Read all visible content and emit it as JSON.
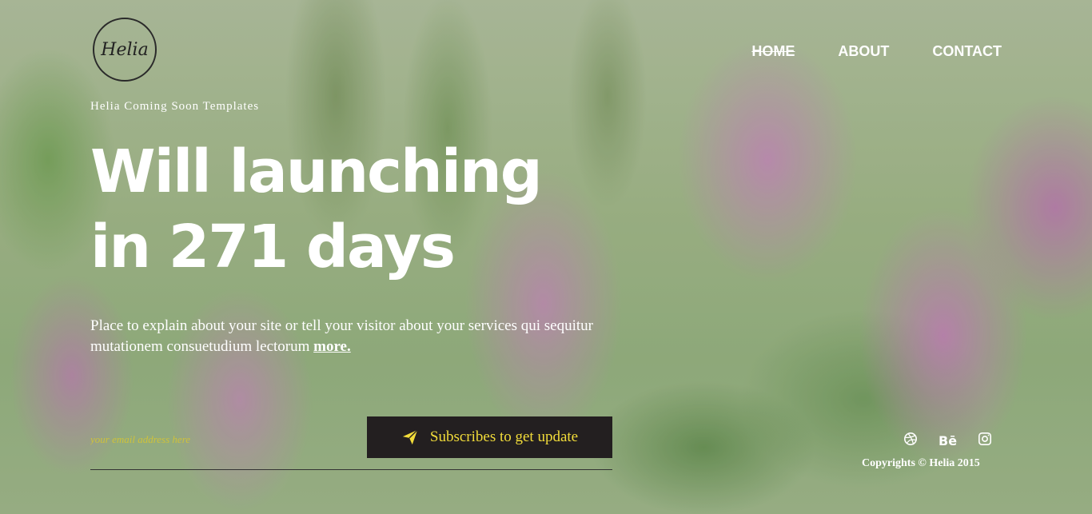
{
  "brand": {
    "logo_text": "Helia",
    "tagline": "Helia Coming Soon Templates"
  },
  "nav": {
    "items": [
      {
        "label": "HOME"
      },
      {
        "label": "ABOUT"
      },
      {
        "label": "CONTACT"
      }
    ]
  },
  "hero": {
    "headline_line1": "Will launching",
    "headline_line2": "in 271 days",
    "description": "Place to explain about your site or tell your visitor about your services qui sequitur mutationem consuetudium lectorum",
    "more_link": "more."
  },
  "subscribe": {
    "placeholder": "your email address here",
    "button_label": "Subscribes to get update",
    "button_icon": "paper-plane-icon"
  },
  "social": {
    "icons": [
      "dribbble-icon",
      "behance-icon",
      "instagram-icon"
    ],
    "behance_text": "Bē"
  },
  "footer": {
    "copyright": "Copyrights © Helia 2015"
  },
  "colors": {
    "accent_yellow": "#f2dc3a",
    "button_bg": "#231f20",
    "text": "#ffffff"
  }
}
